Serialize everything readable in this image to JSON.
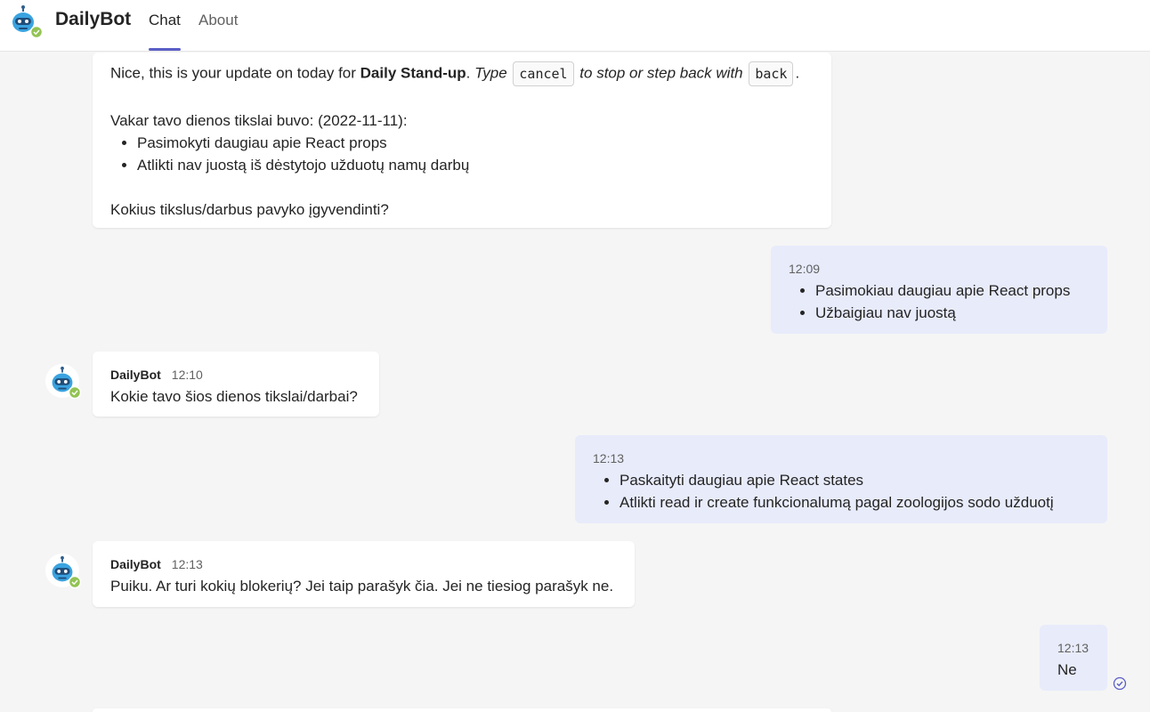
{
  "header": {
    "app_name": "DailyBot",
    "tabs": [
      {
        "label": "Chat",
        "active": true
      },
      {
        "label": "About",
        "active": false
      }
    ],
    "accent_color": "#5b5fc7",
    "status_color": "#92c353"
  },
  "messages": {
    "m1": {
      "intro_prefix": "Nice, this is your update on today for ",
      "intro_bold": "Daily Stand-up",
      "intro_dot": ".",
      "intro_type": " Type ",
      "cancel_code": "cancel",
      "intro_stop": " to stop or step back with ",
      "back_code": "back",
      "intro_end": ".",
      "yesterday_label": "Vakar tavo dienos tikslai buvo: (2022-11-11):",
      "bullets": [
        "Pasimokyti daugiau apie React props",
        "Atlikti nav juostą iš dėstytojo užduotų namų darbų"
      ],
      "question": "Kokius tikslus/darbus pavyko įgyvendinti?"
    },
    "m2": {
      "time": "12:09",
      "bullets": [
        "Pasimokiau daugiau apie React props",
        "Užbaigiau nav juostą"
      ]
    },
    "m3": {
      "sender": "DailyBot",
      "time": "12:10",
      "text": "Kokie tavo šios dienos tikslai/darbai?"
    },
    "m4": {
      "time": "12:13",
      "bullets": [
        "Paskaityti daugiau apie React states",
        "Atlikti read ir create funkcionalumą pagal zoologijos sodo užduotį"
      ]
    },
    "m5": {
      "sender": "DailyBot",
      "time": "12:13",
      "text": "Puiku. Ar turi kokių blokerių? Jei taip parašyk čia. Jei ne tiesiog parašyk ne."
    },
    "m6": {
      "time": "12:13",
      "text": "Ne",
      "status_icon": "seen-check-icon"
    }
  }
}
